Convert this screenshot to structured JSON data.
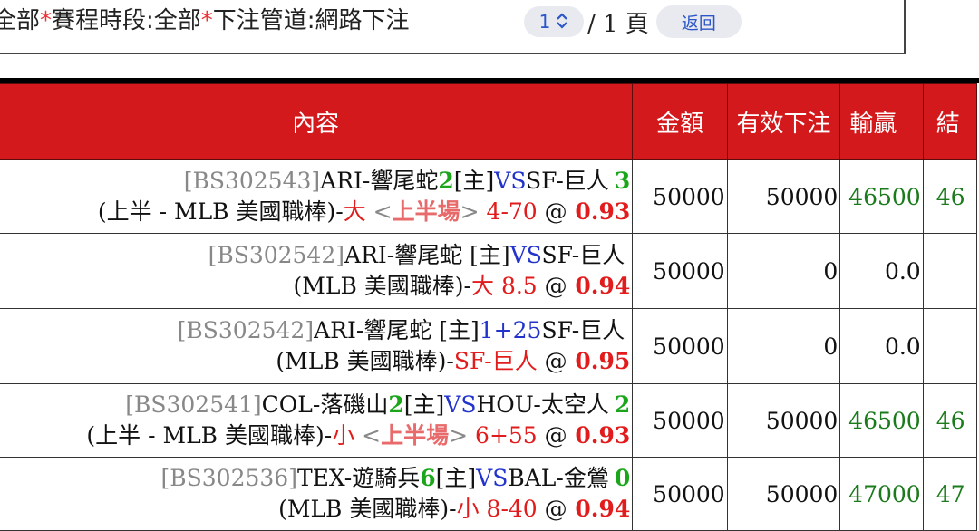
{
  "filter": {
    "prefix": "全部",
    "star": "*",
    "period_label": "賽程時段:全部",
    "channel_label": "下注管道:網路下注"
  },
  "pager": {
    "current": "1",
    "total": "/ 1 頁",
    "back_label": "返回"
  },
  "columns": [
    "內容",
    "金額",
    "有效下注",
    "輸贏",
    "結"
  ],
  "rows": [
    {
      "id": "[BS302543]",
      "home": "ARI-響尾蛇",
      "home_score": "2",
      "home_tag": "[主]",
      "vs": "VS",
      "away": "SF-巨人",
      "away_score": "3",
      "scope": "(上半 - MLB 美國職棒)-",
      "pick": "大",
      "pick_style": "red",
      "half_open": " <",
      "half": "上半場",
      "half_close": ">",
      "line": " 4-70 ",
      "at": "@",
      "odds": " 0.93",
      "amount": "50000",
      "effective": "50000",
      "winloss": "46500",
      "result": "46"
    },
    {
      "id": "[BS302542]",
      "home": "ARI-響尾蛇",
      "home_score": "",
      "home_tag": " [主]",
      "vs": "VS",
      "away": "SF-巨人",
      "away_score": "",
      "scope": "(MLB 美國職棒)-",
      "pick": "大",
      "pick_style": "red",
      "half_open": "",
      "half": "",
      "half_close": "",
      "line": " 8.5 ",
      "at": "@",
      "odds": " 0.94",
      "amount": "50000",
      "effective": "0",
      "winloss": "0.0",
      "result": ""
    },
    {
      "id": "[BS302542]",
      "home": "ARI-響尾蛇",
      "home_score": "",
      "home_tag": " [主]",
      "vs": "1+25",
      "away": "SF-巨人",
      "away_score": "",
      "scope": "(MLB 美國職棒)-",
      "pick": "SF-巨人",
      "pick_style": "red",
      "half_open": "",
      "half": "",
      "half_close": "",
      "line": " ",
      "at": "@",
      "odds": " 0.95",
      "amount": "50000",
      "effective": "0",
      "winloss": "0.0",
      "result": ""
    },
    {
      "id": "[BS302541]",
      "home": "COL-落磯山",
      "home_score": "2",
      "home_tag": "[主]",
      "vs": "VS",
      "away": "HOU-太空人",
      "away_score": "2",
      "scope": "(上半 - MLB 美國職棒)-",
      "pick": "小",
      "pick_style": "red",
      "half_open": " <",
      "half": "上半場",
      "half_close": ">",
      "line": " 6+55 ",
      "at": "@",
      "odds": " 0.93",
      "amount": "50000",
      "effective": "50000",
      "winloss": "46500",
      "result": "46"
    },
    {
      "id": "[BS302536]",
      "home": "TEX-遊騎兵",
      "home_score": "6",
      "home_tag": "[主]",
      "vs": "VS",
      "away": "BAL-金鶯",
      "away_score": "0",
      "scope": "(MLB 美國職棒)-",
      "pick": "小",
      "pick_style": "red",
      "half_open": "",
      "half": "",
      "half_close": "",
      "line": " 8-40 ",
      "at": "@",
      "odds": " 0.94",
      "amount": "50000",
      "effective": "50000",
      "winloss": "47000",
      "result": "47"
    }
  ]
}
